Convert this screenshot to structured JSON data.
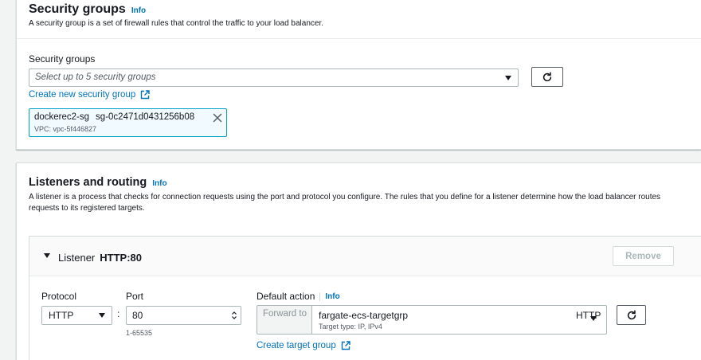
{
  "security": {
    "title": "Security groups",
    "info": "Info",
    "description": "A security group is a set of firewall rules that control the traffic to your load balancer.",
    "field_label": "Security groups",
    "placeholder": "Select up to 5 security groups",
    "create_link": "Create new security group",
    "token": {
      "name": "dockerec2-sg",
      "id": "sg-0c2471d0431256b08",
      "vpc": "VPC: vpc-5f446827"
    }
  },
  "listeners": {
    "title": "Listeners and routing",
    "info": "Info",
    "description": "A listener is a process that checks for connection requests using the port and protocol you configure. The rules that you define for a listener determine how the load balancer routes requests to its registered targets.",
    "listener": {
      "label": "Listener",
      "name": "HTTP:80",
      "remove_label": "Remove",
      "protocol_label": "Protocol",
      "protocol_value": "HTTP",
      "colon": ":",
      "port_label": "Port",
      "port_value": "80",
      "port_hint": "1-65535",
      "default_action_label": "Default action",
      "default_action_info": "Info",
      "forward_to": "Forward to",
      "target_group": "fargate-ecs-targetgrp",
      "target_type": "Target type: IP, IPv4",
      "target_protocol": "HTTP",
      "create_target_link": "Create target group"
    }
  },
  "colors": {
    "link": "#0073bb",
    "token_bg": "#f1faff",
    "token_border": "#00a1c9",
    "page_bg": "#f2f3f3"
  }
}
